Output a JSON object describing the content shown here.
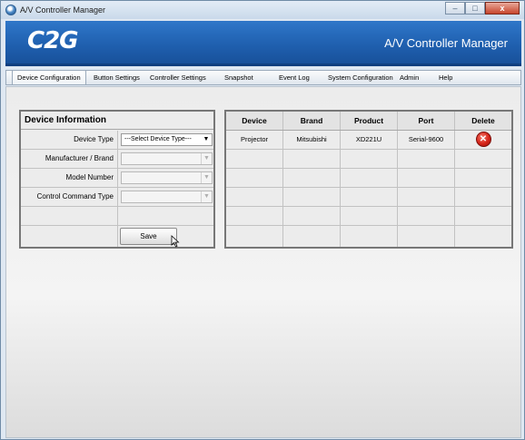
{
  "window": {
    "title": "A/V Controller Manager",
    "minimize_label": "–",
    "maximize_label": "□",
    "close_label": "x"
  },
  "banner": {
    "logo_text": "C2G",
    "app_title": "A/V Controller Manager"
  },
  "menu": {
    "items": [
      {
        "label": "Device Configuration",
        "active": true
      },
      {
        "label": "Button Settings"
      },
      {
        "label": "Controller Settings"
      },
      {
        "label": "Snapshot"
      },
      {
        "label": "Event Log"
      },
      {
        "label": "System Configuration"
      },
      {
        "label": "Admin"
      },
      {
        "label": "Help"
      }
    ]
  },
  "device_info": {
    "title": "Device Information",
    "fields": [
      {
        "label": "Device Type",
        "value": "---Select Device Type---"
      },
      {
        "label": "Manufacturer / Brand",
        "value": ""
      },
      {
        "label": "Model Number",
        "value": ""
      },
      {
        "label": "Control Command Type",
        "value": ""
      }
    ],
    "save_label": "Save"
  },
  "devices_table": {
    "columns": [
      "Device",
      "Brand",
      "Product",
      "Port",
      "Delete"
    ],
    "rows": [
      {
        "device": "Projector",
        "brand": "Mitsubishi",
        "product": "XD221U",
        "port": "Serial-9600"
      }
    ]
  },
  "icons": {
    "app": "controller-app-icon",
    "delete": "delete-x-icon",
    "cursor": "mouse-pointer-icon",
    "dropdown": "dropdown-arrow-icon"
  },
  "colors": {
    "banner": "#1f5fae",
    "delete": "#d52318"
  }
}
